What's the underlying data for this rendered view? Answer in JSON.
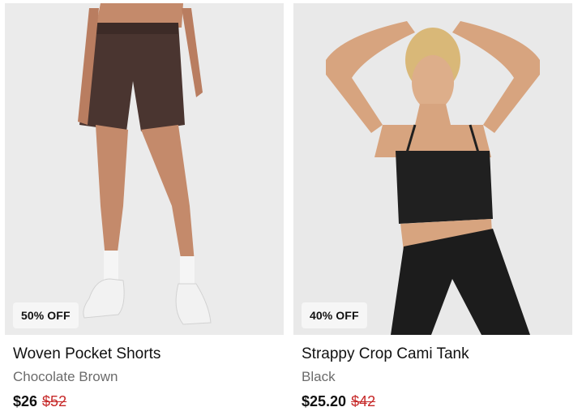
{
  "products": [
    {
      "badge": "50% OFF",
      "title": "Woven Pocket Shorts",
      "variant": "Chocolate Brown",
      "price_now": "$26",
      "price_was": "$52",
      "image_icon": "product-photo-shorts",
      "colors": {
        "shorts": "#4a3530",
        "skin": "#c48a6b",
        "background": "#ebebeb"
      }
    },
    {
      "badge": "40% OFF",
      "title": "Strappy Crop Cami Tank",
      "variant": "Black",
      "price_now": "$25.20",
      "price_was": "$42",
      "image_icon": "product-photo-cami-tank",
      "colors": {
        "top": "#202020",
        "skin": "#d7a47f",
        "background": "#e9e9e9"
      }
    }
  ],
  "colors": {
    "sale_price": "#c62828",
    "muted_text": "#6b6b6b",
    "badge_bg": "#f6f6f6"
  }
}
